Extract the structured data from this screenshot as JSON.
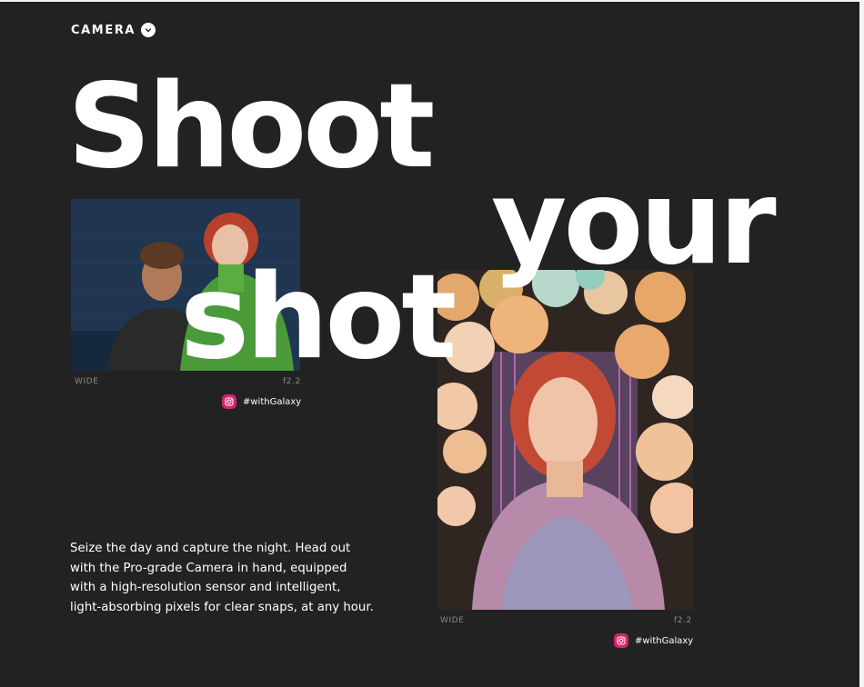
{
  "section": {
    "label": "CAMERA"
  },
  "headline": {
    "line1": "Shoot",
    "line2": "your",
    "line3": "shot"
  },
  "photos": [
    {
      "lens": "WIDE",
      "aperture": "f2.2",
      "tag": "#withGalaxy"
    },
    {
      "lens": "WIDE",
      "aperture": "f2.2",
      "tag": "#withGalaxy"
    }
  ],
  "body": "Seize the day and capture the night. Head out with the Pro-grade Camera in hand, equipped with a high-resolution sensor and intelligent, light-absorbing pixels for clear snaps, at any hour.",
  "colors": {
    "background": "#222222",
    "text": "#ffffff",
    "meta": "#8a8a8a",
    "tag_icon": "#d4246a"
  },
  "icons": [
    "chevron-down-icon",
    "instagram-icon"
  ]
}
